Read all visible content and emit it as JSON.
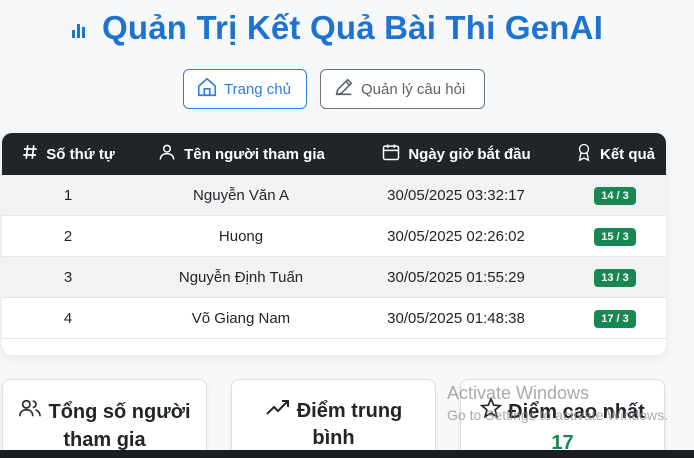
{
  "page": {
    "title": "Quản Trị Kết Quả Bài Thi GenAI"
  },
  "nav": {
    "home_label": "Trang chủ",
    "questions_label": "Quản lý câu hỏi"
  },
  "table": {
    "headers": [
      "Số thứ tự",
      "Tên người tham gia",
      "Ngày giờ bắt đầu",
      "Kết quả"
    ],
    "rows": [
      {
        "index": "1",
        "name": "Nguyễn Văn A",
        "start": "30/05/2025 03:32:17",
        "result": "14 / 3"
      },
      {
        "index": "2",
        "name": "Huong",
        "start": "30/05/2025 02:26:02",
        "result": "15 / 3"
      },
      {
        "index": "3",
        "name": "Nguyễn Định Tuấn",
        "start": "30/05/2025 01:55:29",
        "result": "13 / 3"
      },
      {
        "index": "4",
        "name": "Võ Giang Nam",
        "start": "30/05/2025 01:48:38",
        "result": "17 / 3"
      }
    ]
  },
  "stats": {
    "total_label_1": "Tổng số người",
    "total_label_2": "tham gia",
    "avg_label_1": "Điểm trung",
    "avg_label_2": "bình",
    "max_label": "Điểm cao nhất",
    "max_value": "17"
  },
  "watermark": {
    "line1": "Activate Windows",
    "line2": "Go to Settings to activate Windows."
  },
  "colors": {
    "accent": "#1e73d1",
    "success": "#198754",
    "header_bg": "#212529"
  },
  "icons": [
    "bar-chart-icon",
    "home-icon",
    "pencil-icon",
    "hash-icon",
    "person-icon",
    "calendar-icon",
    "award-icon",
    "people-icon",
    "trend-up-icon",
    "star-icon"
  ]
}
